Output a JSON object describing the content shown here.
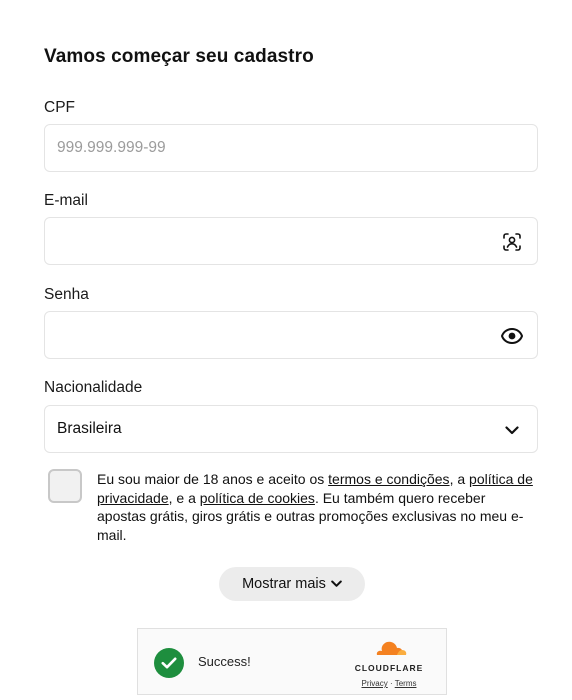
{
  "form": {
    "title": "Vamos começar seu cadastro",
    "cpf": {
      "label": "CPF",
      "placeholder": "999.999.999-99",
      "value": ""
    },
    "email": {
      "label": "E-mail",
      "value": "",
      "icon": "contact-autofill-icon"
    },
    "password": {
      "label": "Senha",
      "value": "",
      "icon": "eye-icon"
    },
    "nationality": {
      "label": "Nacionalidade",
      "selected": "Brasileira",
      "icon": "chevron-down-icon"
    },
    "consent": {
      "checked": false,
      "text_1": "Eu sou maior de 18 anos e aceito os ",
      "terms_link": "termos e condições",
      "text_2": ", a ",
      "privacy_link": "política de privacidade",
      "text_3": ", e a ",
      "cookies_link": "política de cookies",
      "text_4": ". Eu também quero receber apostas grátis, giros grátis e outras promoções exclusivas no meu e-mail."
    },
    "show_more_label": "Mostrar mais"
  },
  "captcha": {
    "status": "Success!",
    "brand": "CLOUDFLARE",
    "privacy_link": "Privacy",
    "separator": " · ",
    "terms_link": "Terms",
    "colors": {
      "success": "#1e8e3e",
      "cloud_orange": "#f48120",
      "cloud_light": "#faad3f"
    }
  }
}
